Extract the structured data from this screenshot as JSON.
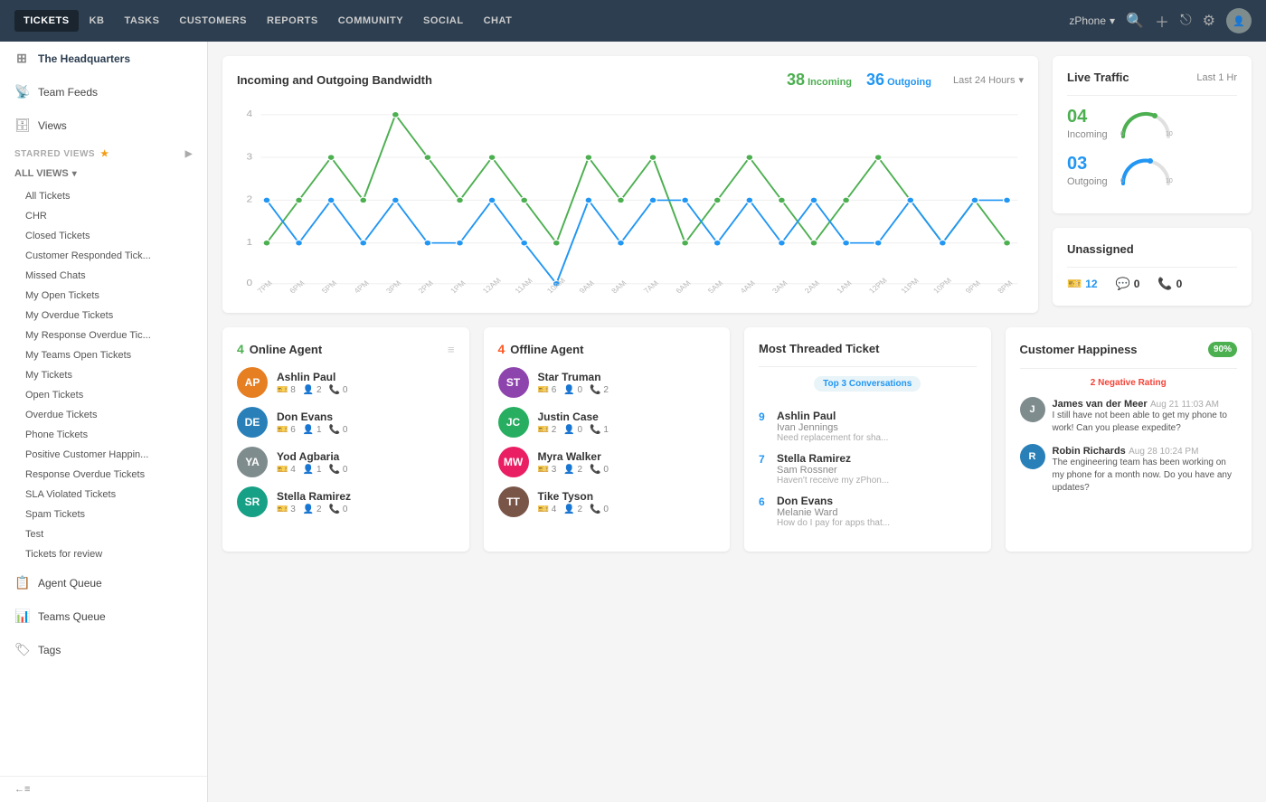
{
  "nav": {
    "items": [
      {
        "label": "TICKETS",
        "active": true
      },
      {
        "label": "KB",
        "active": false
      },
      {
        "label": "TASKS",
        "active": false
      },
      {
        "label": "CUSTOMERS",
        "active": false
      },
      {
        "label": "REPORTS",
        "active": false
      },
      {
        "label": "COMMUNITY",
        "active": false
      },
      {
        "label": "SOCIAL",
        "active": false
      },
      {
        "label": "CHAT",
        "active": false
      }
    ],
    "zphone": "zPhone",
    "right_icons": [
      "search",
      "plus",
      "external",
      "settings"
    ]
  },
  "sidebar": {
    "items": [
      {
        "id": "headquarters",
        "label": "The Headquarters",
        "icon": "⊞",
        "active": true
      },
      {
        "id": "team-feeds",
        "label": "Team Feeds",
        "icon": "📡"
      },
      {
        "id": "views",
        "label": "Views",
        "icon": "🗄"
      }
    ],
    "starred_views": "STARRED VIEWS",
    "all_views": "ALL VIEWS",
    "view_list": [
      "All Tickets",
      "CHR",
      "Closed Tickets",
      "Customer Responded Tick...",
      "Missed Chats",
      "My Open Tickets",
      "My Overdue Tickets",
      "My Response Overdue Tic...",
      "My Teams Open Tickets",
      "My Tickets",
      "Open Tickets",
      "Overdue Tickets",
      "Phone Tickets",
      "Positive Customer Happin...",
      "Response Overdue Tickets",
      "SLA Violated Tickets",
      "Spam Tickets",
      "Test",
      "Tickets for review"
    ],
    "bottom_items": [
      {
        "label": "Agent Queue",
        "icon": "📋"
      },
      {
        "label": "Teams Queue",
        "icon": "📊"
      },
      {
        "label": "Tags",
        "icon": "🏷"
      }
    ],
    "collapse_label": "←≡"
  },
  "bandwidth": {
    "title": "Incoming and Outgoing Bandwidth",
    "filter": "Last 24 Hours",
    "incoming_count": "38",
    "incoming_label": "Incoming",
    "outgoing_count": "36",
    "outgoing_label": "Outgoing"
  },
  "live_traffic": {
    "title": "Live Traffic",
    "time_label": "Last 1 Hr",
    "incoming_num": "04",
    "incoming_label": "Incoming",
    "outgoing_num": "03",
    "outgoing_label": "Outgoing"
  },
  "unassigned": {
    "title": "Unassigned",
    "ticket_count": "12",
    "chat_count": "0",
    "call_count": "0"
  },
  "online_agents": {
    "title": "Online Agent",
    "count": "4",
    "agents": [
      {
        "name": "Ashlin Paul",
        "tickets": "8",
        "chats": "2",
        "calls": "0",
        "initials": "AP",
        "color": "av-orange"
      },
      {
        "name": "Don Evans",
        "tickets": "6",
        "chats": "1",
        "calls": "0",
        "initials": "DE",
        "color": "av-blue"
      },
      {
        "name": "Yod Agbaria",
        "tickets": "4",
        "chats": "1",
        "calls": "0",
        "initials": "YA",
        "color": "av-gray"
      },
      {
        "name": "Stella Ramirez",
        "tickets": "3",
        "chats": "2",
        "calls": "0",
        "initials": "SR",
        "color": "av-teal"
      }
    ]
  },
  "offline_agents": {
    "title": "Offline Agent",
    "count": "4",
    "agents": [
      {
        "name": "Star Truman",
        "tickets": "6",
        "chats": "0",
        "calls": "2",
        "initials": "ST",
        "color": "av-purple"
      },
      {
        "name": "Justin Case",
        "tickets": "2",
        "chats": "0",
        "calls": "1",
        "initials": "JC",
        "color": "av-green"
      },
      {
        "name": "Myra Walker",
        "tickets": "3",
        "chats": "2",
        "calls": "0",
        "initials": "MW",
        "color": "av-pink"
      },
      {
        "name": "Tike Tyson",
        "tickets": "4",
        "chats": "2",
        "calls": "0",
        "initials": "TT",
        "color": "av-brown"
      }
    ]
  },
  "threaded": {
    "title": "Most Threaded Ticket",
    "badge": "Top 3 Conversations",
    "items": [
      {
        "num": "9",
        "name": "Ashlin Paul",
        "sub": "Ivan Jennings",
        "excerpt": "Need replacement for sha..."
      },
      {
        "num": "7",
        "name": "Stella Ramirez",
        "sub": "Sam Rossner",
        "excerpt": "Haven't receive my zPhon..."
      },
      {
        "num": "6",
        "name": "Don Evans",
        "sub": "Melanie Ward",
        "excerpt": "How do I pay for apps that..."
      }
    ]
  },
  "happiness": {
    "title": "Customer Happiness",
    "percentage": "90%",
    "negative_label": "2 Negative Rating",
    "feedbacks": [
      {
        "initial": "J",
        "color": "av-gray",
        "name": "James van der Meer",
        "date": "Aug 21 11:03 AM",
        "text": "I still have not been able to get my phone to work! Can you please expedite?"
      },
      {
        "initial": "R",
        "color": "av-blue",
        "name": "Robin Richards",
        "date": "Aug 28 10:24 PM",
        "text": "The engineering team has been working on my phone for a month now. Do you have any updates?"
      }
    ]
  }
}
